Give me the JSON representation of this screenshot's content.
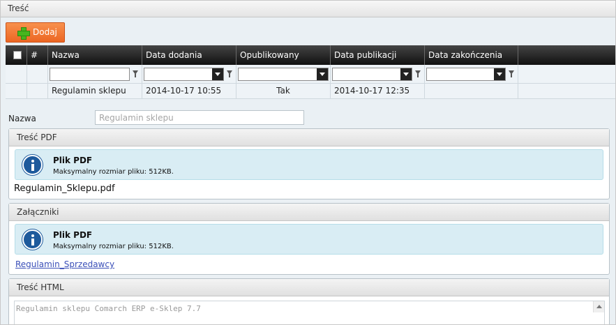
{
  "window": {
    "title": "Treść"
  },
  "toolbar": {
    "add_label": "Dodaj",
    "add_icon": "plus-icon"
  },
  "grid": {
    "columns": [
      "#",
      "Nazwa",
      "Data dodania",
      "Opublikowany",
      "Data publikacji",
      "Data zakończenia"
    ],
    "rows": [
      {
        "nazwa": "Regulamin sklepu",
        "data_dodania": "2014-10-17 10:55",
        "opublikowany": "Tak",
        "data_publikacji": "2014-10-17 12:35",
        "data_zakonczenia": ""
      }
    ]
  },
  "form": {
    "name_label": "Nazwa",
    "name_placeholder": "Regulamin sklepu"
  },
  "pdf_panel": {
    "title": "Treść PDF",
    "info_title": "Plik PDF",
    "info_text": "Maksymalny rozmiar pliku: 512KB.",
    "file_name": "Regulamin_Sklepu.pdf"
  },
  "attachments_panel": {
    "title": "Załączniki",
    "info_title": "Plik PDF",
    "info_text": "Maksymalny rozmiar pliku: 512KB.",
    "link_text": "Regulamin_Sprzedawcy"
  },
  "html_panel": {
    "title": "Treść HTML",
    "content": "Regulamin sklepu Comarch ERP e-Sklep 7.7"
  },
  "colors": {
    "accent": "#ec6623",
    "header_dark": "#222222",
    "info_bg": "#d9edf4",
    "link": "#3a4fb8"
  }
}
